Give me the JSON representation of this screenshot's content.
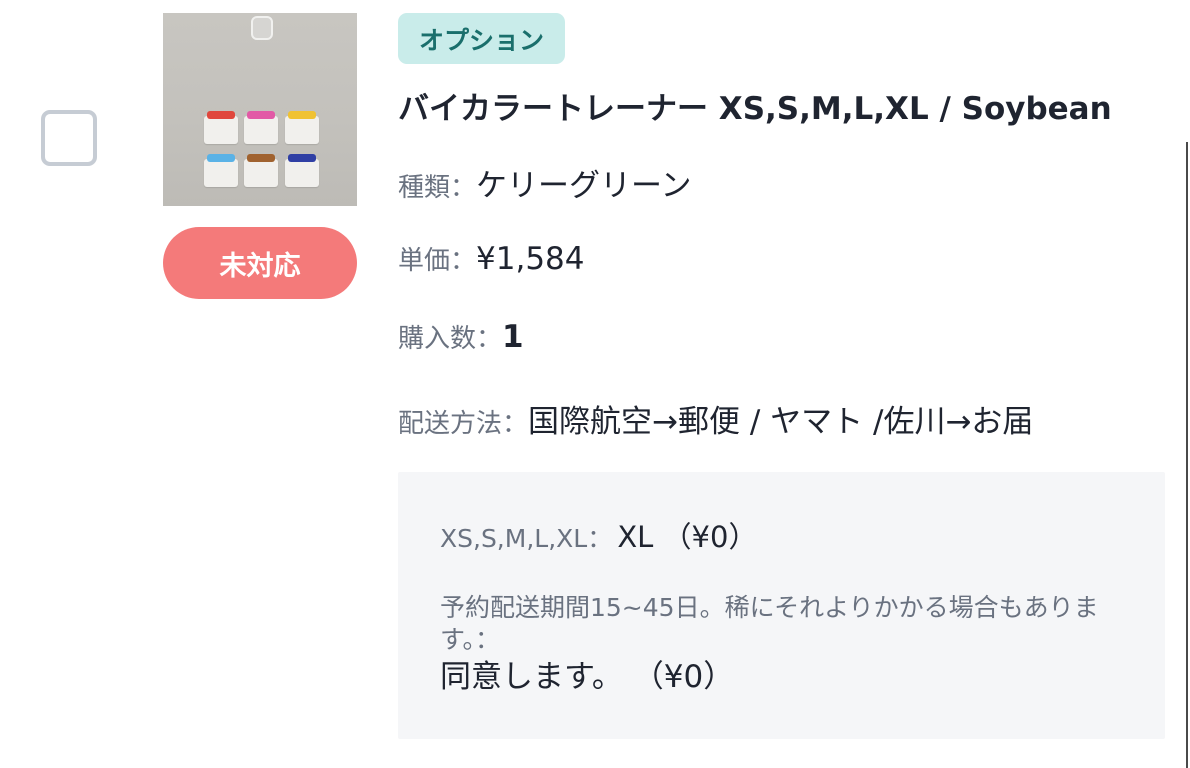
{
  "order_item": {
    "option_tag": "オプション",
    "title": "バイカラートレーナー XS,S,M,L,XL / Soybean",
    "status_label": "未対応",
    "thumbnail_icon": "product-photo-sweatshirts",
    "kind": {
      "label": "種類：",
      "value": "ケリーグリーン"
    },
    "unit_price": {
      "label": "単価：",
      "value": "¥1,584"
    },
    "quantity": {
      "label": "購入数：",
      "value": "1"
    },
    "shipping": {
      "label": "配送方法：",
      "value": "国際航空→郵便 / ヤマト /佐川→お届"
    },
    "options": [
      {
        "label": "XS,S,M,L,XL：",
        "value": "XL （¥0）"
      },
      {
        "label": "予約配送期間15~45日。稀にそれよりかかる場合もあります。：",
        "value": "同意します。 （¥0）"
      }
    ]
  },
  "colors": {
    "status_pill": "#f47a7a",
    "tag_bg": "#c9ecea",
    "tag_text": "#1a6f6c",
    "option_box_bg": "#f5f6f8",
    "tee_collars": [
      "#e0473d",
      "#e25aa6",
      "#f0c233",
      "#5ab2e6",
      "#a0622f",
      "#2f3fa4"
    ]
  }
}
